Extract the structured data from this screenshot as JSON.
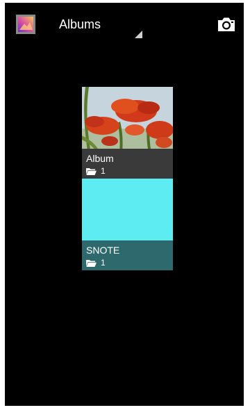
{
  "action_bar": {
    "app_icon": "gallery-app-icon",
    "spinner_label": "Albums",
    "camera_icon": "camera-icon"
  },
  "albums": [
    {
      "name": "Album",
      "count": "1",
      "thumbnail": "red-poppies-photo",
      "folder_icon": "folder-icon",
      "caption_color": "#3a3a3a"
    },
    {
      "name": "SNOTE",
      "count": "1",
      "thumbnail": "solid-cyan-image",
      "thumbnail_color": "#5cecf2",
      "folder_icon": "folder-icon",
      "caption_color": "#2e6a6d"
    }
  ]
}
